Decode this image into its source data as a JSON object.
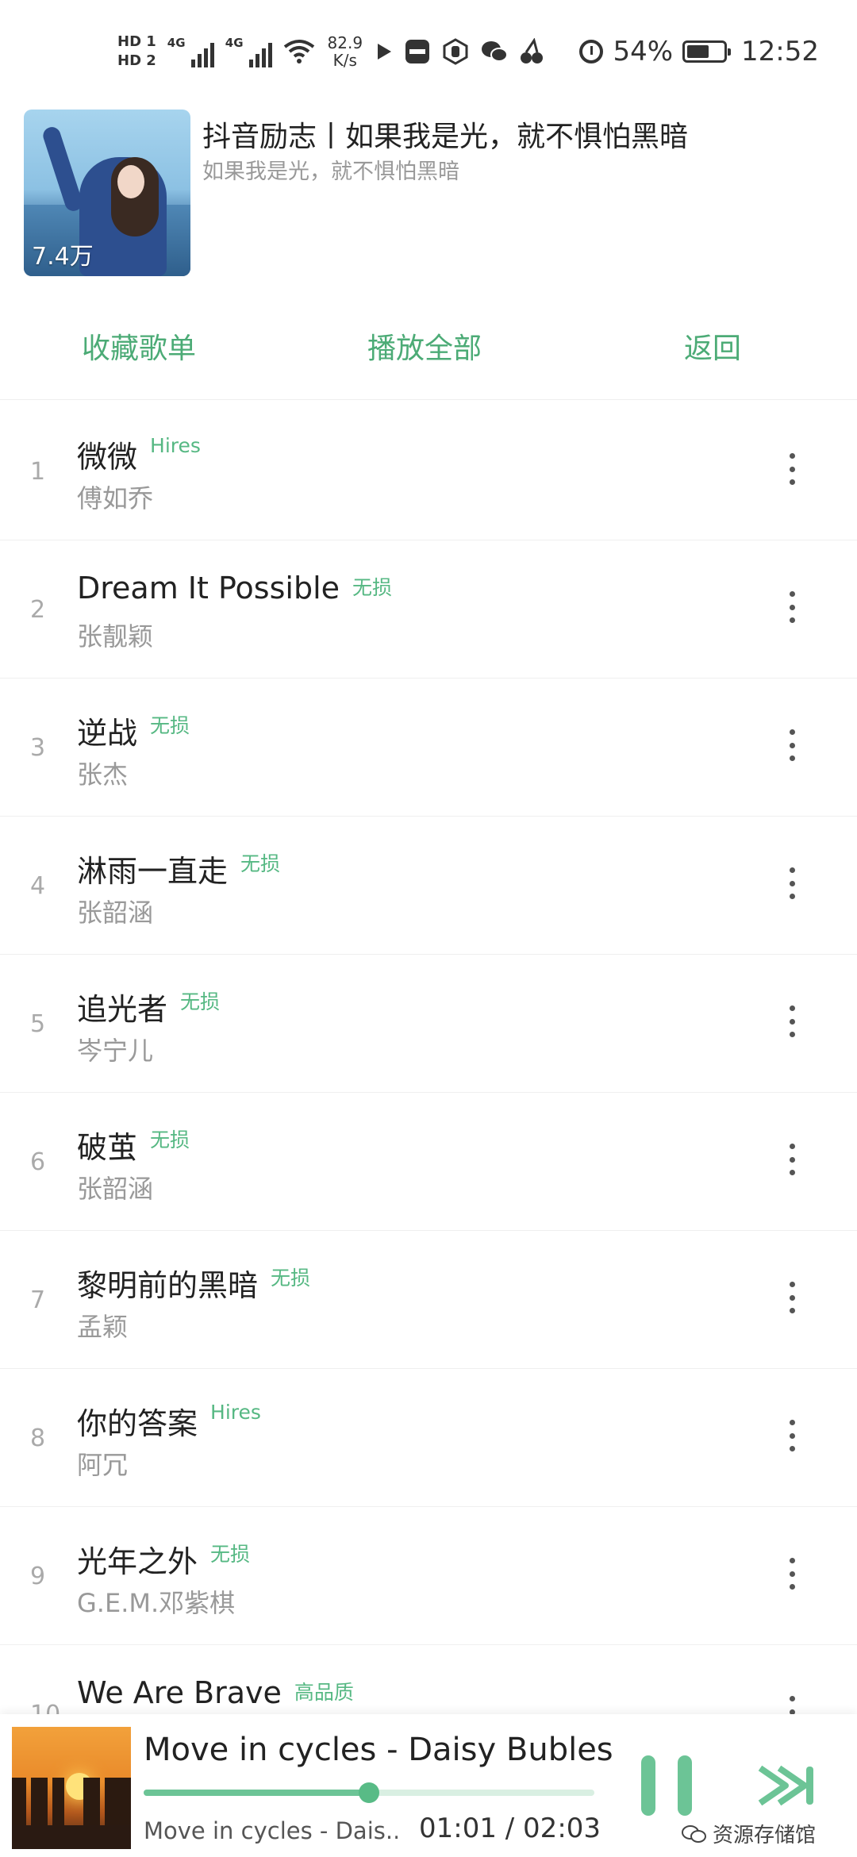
{
  "status_bar": {
    "hd1": "HD 1",
    "hd2": "HD 2",
    "net1": "4G",
    "net2": "4G",
    "speed_value": "82.9",
    "speed_unit": "K/s",
    "battery": "54%",
    "time": "12:52"
  },
  "playlist": {
    "cover_count": "7.4万",
    "title": "抖音励志丨如果我是光，就不惧怕黑暗",
    "subtitle": "如果我是光，就不惧怕黑暗"
  },
  "actions": {
    "collect": "收藏歌单",
    "play_all": "播放全部",
    "back": "返回"
  },
  "songs": [
    {
      "num": "1",
      "title": "微微",
      "quality": "Hires",
      "artist": "傅如乔"
    },
    {
      "num": "2",
      "title": "Dream It Possible",
      "quality": "无损",
      "artist": "张靓颖"
    },
    {
      "num": "3",
      "title": "逆战",
      "quality": "无损",
      "artist": "张杰"
    },
    {
      "num": "4",
      "title": "淋雨一直走",
      "quality": "无损",
      "artist": "张韶涵"
    },
    {
      "num": "5",
      "title": "追光者",
      "quality": "无损",
      "artist": "岑宁儿"
    },
    {
      "num": "6",
      "title": "破茧",
      "quality": "无损",
      "artist": "张韶涵"
    },
    {
      "num": "7",
      "title": "黎明前的黑暗",
      "quality": "无损",
      "artist": "孟颖"
    },
    {
      "num": "8",
      "title": "你的答案",
      "quality": "Hires",
      "artist": "阿冗"
    },
    {
      "num": "9",
      "title": "光年之外",
      "quality": "无损",
      "artist": "G.E.M.邓紫棋"
    },
    {
      "num": "10",
      "title": "We Are Brave",
      "quality": "高品质",
      "artist": ""
    }
  ],
  "player": {
    "title": "Move in cycles - Daisy Bubles",
    "subtitle": "Move in cycles - Dais...",
    "time": "01:01 / 02:03",
    "progress": 0.5
  },
  "watermark": "资源存储馆",
  "colors": {
    "accent": "#4cab76",
    "quality_tag": "#56b883",
    "progress_fill": "#6cc496",
    "progress_track": "#d9efe2"
  },
  "icons": {
    "more": "vertical-dots-icon",
    "pause": "pause-icon",
    "next": "skip-next-icon"
  }
}
